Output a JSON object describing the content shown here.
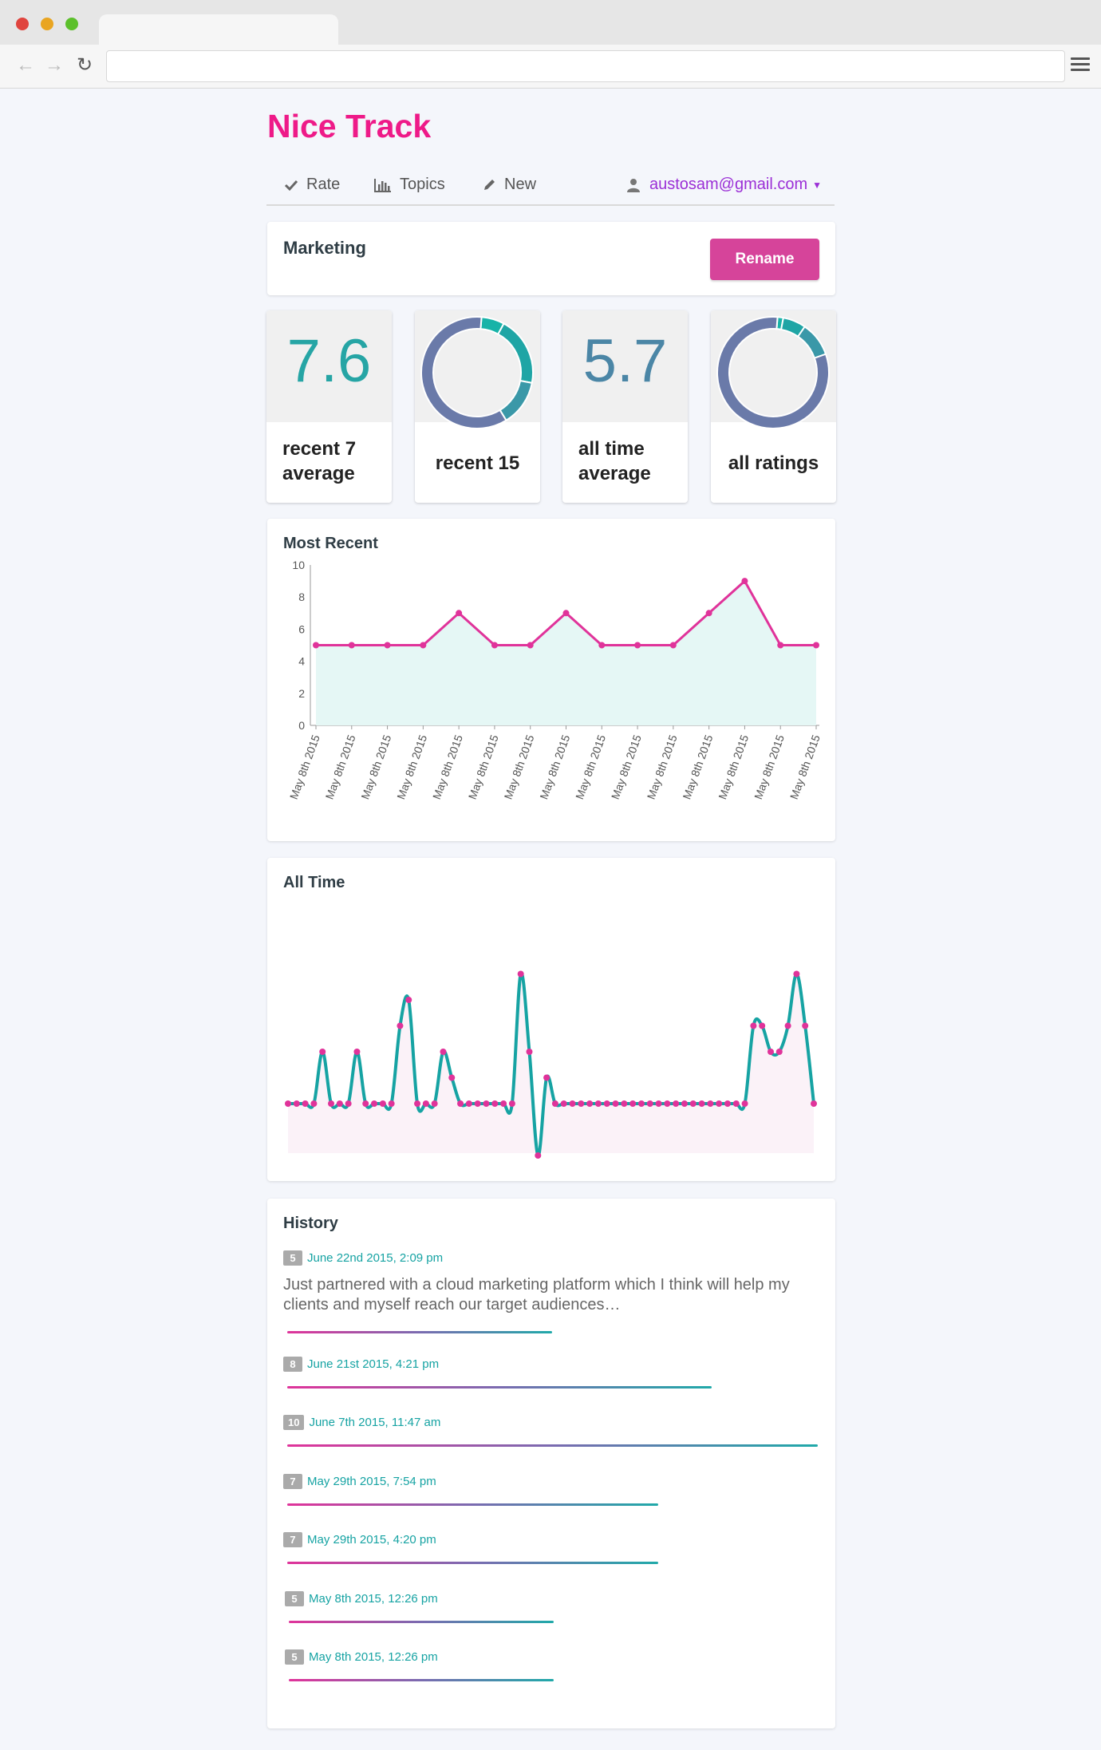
{
  "browser": {
    "url": ""
  },
  "app": {
    "title": "Nice Track"
  },
  "nav": {
    "rate": "Rate",
    "topics": "Topics",
    "new": "New",
    "user": "austosam@gmail.com"
  },
  "topic": {
    "name": "Marketing",
    "rename_label": "Rename"
  },
  "stats": {
    "recent_avg": {
      "value": "7.6",
      "label": "recent 7 average"
    },
    "recent_15": {
      "label": "recent 15"
    },
    "all_time_avg": {
      "value": "5.7",
      "label": "all time average"
    },
    "all_ratings": {
      "label": "all ratings"
    }
  },
  "colors": {
    "pink": "#e0339a",
    "teal": "#16a3a3",
    "slate": "#6a7aa9",
    "brand": "#ee1a88"
  },
  "chart_data": [
    {
      "type": "area",
      "title": "Most Recent",
      "x": [
        "May 8th 2015",
        "May 8th 2015",
        "May 8th 2015",
        "May 8th 2015",
        "May 8th 2015",
        "May 8th 2015",
        "May 8th 2015",
        "May 8th 2015",
        "May 8th 2015",
        "May 8th 2015",
        "May 8th 2015",
        "May 8th 2015",
        "May 8th 2015",
        "May 8th 2015",
        "May 8th 2015"
      ],
      "values": [
        5,
        5,
        5,
        5,
        7,
        5,
        5,
        7,
        5,
        5,
        5,
        7,
        9,
        5,
        5
      ],
      "ylim": [
        0,
        10
      ],
      "yticks": [
        "10",
        "8",
        "6",
        "4",
        "2",
        "0"
      ]
    },
    {
      "type": "line",
      "title": "All Time",
      "values": [
        5,
        5,
        5,
        5,
        7,
        5,
        5,
        5,
        7,
        5,
        5,
        5,
        5,
        8,
        9,
        5,
        5,
        5,
        7,
        6,
        5,
        5,
        5,
        5,
        5,
        5,
        5,
        10,
        7,
        3,
        6,
        5,
        5,
        5,
        5,
        5,
        5,
        5,
        5,
        5,
        5,
        5,
        5,
        5,
        5,
        5,
        5,
        5,
        5,
        5,
        5,
        5,
        5,
        5,
        8,
        8,
        7,
        7,
        8,
        10,
        8,
        5
      ]
    },
    {
      "type": "pie",
      "title": "recent 15",
      "values": [
        1,
        3,
        2,
        9
      ]
    },
    {
      "type": "pie",
      "title": "all ratings",
      "values": [
        1,
        4,
        6,
        49
      ]
    }
  ],
  "history": {
    "title": "History",
    "items": [
      {
        "rating": "5",
        "date": "June 22nd 2015, 2:09 pm",
        "text": "Just partnered with a cloud marketing platform which I think will help my clients and myself reach our target audiences…"
      },
      {
        "rating": "8",
        "date": "June 21st 2015, 4:21 pm",
        "text": ""
      },
      {
        "rating": "10",
        "date": "June 7th 2015, 11:47 am",
        "text": ""
      },
      {
        "rating": "7",
        "date": "May 29th 2015, 7:54 pm",
        "text": ""
      },
      {
        "rating": "7",
        "date": "May 29th 2015, 4:20 pm",
        "text": ""
      },
      {
        "rating": "5",
        "date": "May 8th 2015, 12:26 pm",
        "text": ""
      },
      {
        "rating": "5",
        "date": "May 8th 2015, 12:26 pm",
        "text": ""
      }
    ]
  }
}
